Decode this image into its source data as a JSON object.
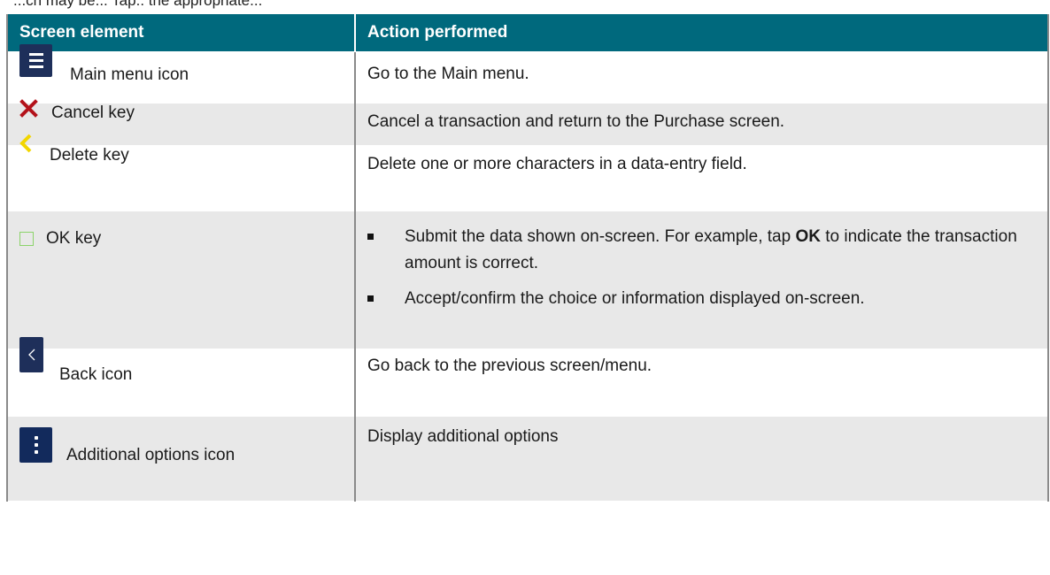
{
  "top_clip": "...ch may be... Tap.. the appropriate...",
  "header": {
    "col1": "Screen element",
    "col2": "Action performed"
  },
  "rows": [
    {
      "label": "Main menu icon",
      "icon": "hamburger-menu-icon",
      "action": "Go to the Main menu."
    },
    {
      "label": "Cancel key",
      "icon": "red-x-icon",
      "action": "Cancel a transaction and return to the Purchase screen."
    },
    {
      "label": "Delete key",
      "icon": "yellow-chevron-left-icon",
      "action": "Delete one or more characters in a data-entry field."
    },
    {
      "label": "OK key",
      "icon": "green-square-icon",
      "bullets": [
        {
          "pre": "Submit the data shown on-screen. For example, tap ",
          "bold": "OK",
          "post": " to indicate the transaction amount is correct."
        },
        {
          "text": "Accept/confirm the choice or information displayed on-screen."
        }
      ]
    },
    {
      "label": "Back icon",
      "icon": "back-chevron-icon",
      "action": "Go back to the previous screen/menu."
    },
    {
      "label": "Additional options icon",
      "icon": "vertical-dots-icon",
      "action": "Display additional options"
    }
  ],
  "colors": {
    "header_bg": "#00697d",
    "grey_row": "#e8e8e8",
    "icon_navy": "#1e2f5a",
    "cancel_red": "#b3121a",
    "delete_yellow": "#f2d600",
    "ok_green": "#8bd36a"
  }
}
